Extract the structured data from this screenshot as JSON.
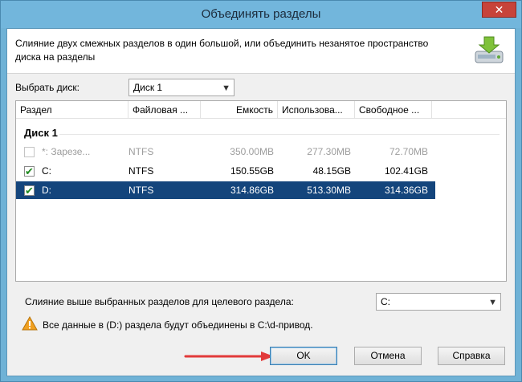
{
  "window": {
    "title": "Объединять разделы",
    "close_label": "✕"
  },
  "header": {
    "description": "Слияние двух смежных разделов в один большой, или объединить незанятое пространство диска на разделы",
    "icon": "merge-disk-icon"
  },
  "disk_select": {
    "label": "Выбрать диск:",
    "value": "Диск 1"
  },
  "table": {
    "columns": [
      "Раздел",
      "Файловая ...",
      "Емкость",
      "Использова...",
      "Свободное ..."
    ],
    "group": "Диск 1",
    "rows": [
      {
        "checked": false,
        "partition": "*: Зарезе...",
        "fs": "NTFS",
        "capacity": "350.00MB",
        "used": "277.30MB",
        "free": "72.70MB",
        "state": "disabled"
      },
      {
        "checked": true,
        "partition": "C:",
        "fs": "NTFS",
        "capacity": "150.55GB",
        "used": "48.15GB",
        "free": "102.41GB",
        "state": "normal"
      },
      {
        "checked": true,
        "partition": "D:",
        "fs": "NTFS",
        "capacity": "314.86GB",
        "used": "513.30MB",
        "free": "314.36GB",
        "state": "selected"
      }
    ]
  },
  "target": {
    "label": "Слияние выше выбранных разделов для целевого раздела:",
    "value": "C:"
  },
  "warning": {
    "icon": "warning-icon",
    "text": "Все данные в (D:) раздела будут объединены в C:\\d-привод."
  },
  "buttons": {
    "ok": "OK",
    "cancel": "Отмена",
    "help": "Справка"
  },
  "colors": {
    "titlebar": "#72b6dc",
    "selection": "#14457c",
    "check": "#1f8a1f",
    "annotation_arrow": "#e23a3a",
    "warning": "#f0a020"
  }
}
